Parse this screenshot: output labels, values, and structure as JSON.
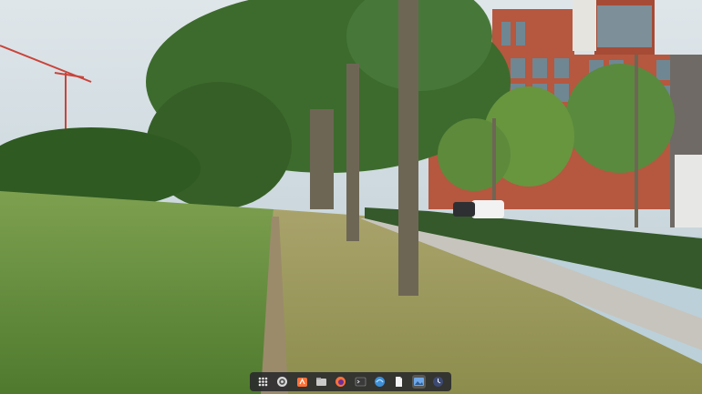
{
  "desktop": {
    "wallpaper_icon": "wallpaper-photo",
    "wallpaper_description_hidden": true
  },
  "dock": {
    "items": [
      {
        "icon": "applications-grid-icon",
        "active": false
      },
      {
        "icon": "system-settings-icon",
        "active": false
      },
      {
        "icon": "software-center-icon",
        "active": false
      },
      {
        "icon": "file-manager-icon",
        "active": false
      },
      {
        "icon": "firefox-icon",
        "active": false
      },
      {
        "icon": "terminal-icon",
        "active": false
      },
      {
        "icon": "browser-icon",
        "active": false
      },
      {
        "icon": "text-editor-icon",
        "active": false
      },
      {
        "icon": "image-viewer-icon",
        "active": true
      },
      {
        "icon": "clock-icon",
        "active": false
      }
    ]
  },
  "colors": {
    "dock_bg": "#2b2b2f",
    "firefox_orange": "#ff7139",
    "settings_blue": "#3d8fd6"
  }
}
